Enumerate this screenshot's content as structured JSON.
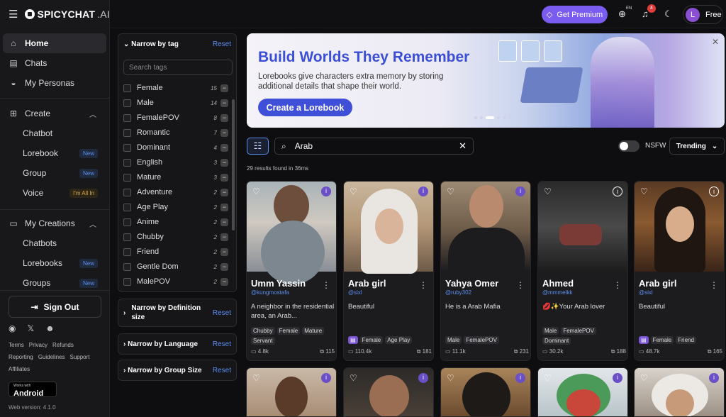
{
  "brand": {
    "name": "SPICYCHAT",
    "suffix": ".AI"
  },
  "nav": {
    "home": "Home",
    "chats": "Chats",
    "personas": "My Personas",
    "create": "Create",
    "chatbot": "Chatbot",
    "lorebook": "Lorebook",
    "group": "Group",
    "voice": "Voice",
    "my_creations": "My Creations",
    "chatbots": "Chatbots",
    "lorebooks": "Lorebooks",
    "groups": "Groups",
    "new": "New",
    "im_all_in": "I'm All In"
  },
  "sign_out": "Sign Out",
  "footer_links": [
    "Terms",
    "Privacy",
    "Refunds",
    "Reporting",
    "Guidelines",
    "Support",
    "Affiliates"
  ],
  "android": {
    "small": "Works with",
    "big": "Android"
  },
  "version": "Web version: 4.1.0",
  "topbar": {
    "premium": "Get Premium",
    "lang": "EN",
    "notif_count": "4",
    "avatar_letter": "L",
    "plan": "Free"
  },
  "filters": {
    "narrow_tag": "Narrow by tag",
    "reset": "Reset",
    "search_placeholder": "Search tags",
    "definition": "Narrow by Definition size",
    "language": "Narrow by Language",
    "group_size": "Narrow by Group Size"
  },
  "tags": [
    {
      "name": "Female",
      "count": "15"
    },
    {
      "name": "Male",
      "count": "14"
    },
    {
      "name": "FemalePOV",
      "count": "8"
    },
    {
      "name": "Romantic",
      "count": "7"
    },
    {
      "name": "Dominant",
      "count": "4"
    },
    {
      "name": "English",
      "count": "3"
    },
    {
      "name": "Mature",
      "count": "3"
    },
    {
      "name": "Adventure",
      "count": "2"
    },
    {
      "name": "Age Play",
      "count": "2"
    },
    {
      "name": "Anime",
      "count": "2"
    },
    {
      "name": "Chubby",
      "count": "2"
    },
    {
      "name": "Friend",
      "count": "2"
    },
    {
      "name": "Gentle Dom",
      "count": "2"
    },
    {
      "name": "MalePOV",
      "count": "2"
    }
  ],
  "banner": {
    "title": "Build Worlds They Remember",
    "text": "Lorebooks give characters extra memory by storing additional details that shape their world.",
    "button": "Create a Lorebook"
  },
  "search": {
    "value": "Arab",
    "nsfw": "NSFW",
    "sort": "Trending",
    "results": "29 results found in 36ms"
  },
  "cards": [
    {
      "name": "Umm Yassin",
      "user": "@kungmostafa",
      "desc": "A neighbor in the residential area, an Arab...",
      "tags": [
        "Chubby",
        "Female",
        "Mature",
        "Servant"
      ],
      "chats": "4.8k",
      "msgs": "115"
    },
    {
      "name": "Arab girl",
      "user": "@sixl",
      "desc": "Beautiful",
      "tags": [
        "Female",
        "Age Play"
      ],
      "chats": "110.4k",
      "msgs": "181"
    },
    {
      "name": "Yahya Omer",
      "user": "@ruby302",
      "desc": "He is a Arab Mafia",
      "tags": [
        "Male",
        "FemalePOV"
      ],
      "chats": "11.1k",
      "msgs": "231"
    },
    {
      "name": "Ahmed",
      "user": "@mmmelkk",
      "desc": "💋✨Your Arab lover",
      "tags": [
        "Male",
        "FemalePOV",
        "Dominant"
      ],
      "chats": "30.2k",
      "msgs": "188"
    },
    {
      "name": "Arab girl",
      "user": "@sixl",
      "desc": "Beautiful",
      "tags": [
        "Female",
        "Friend"
      ],
      "chats": "48.7k",
      "msgs": "165"
    }
  ]
}
